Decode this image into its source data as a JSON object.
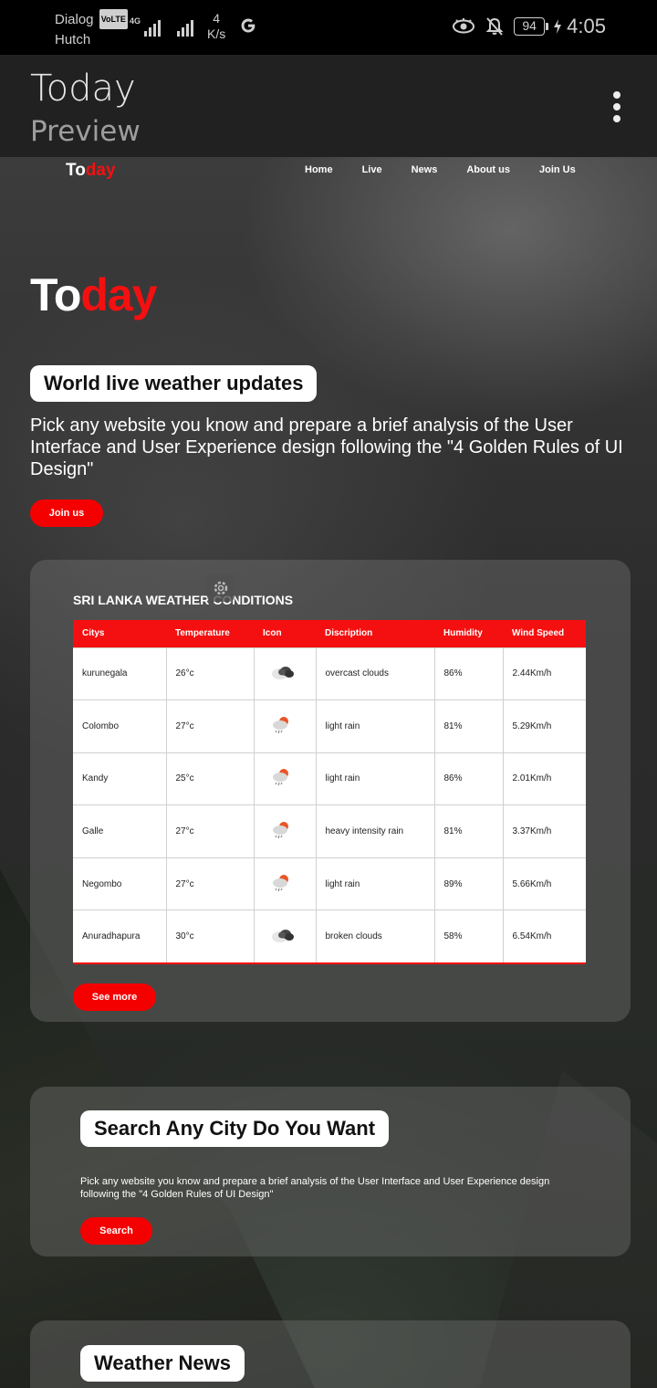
{
  "status_bar": {
    "carrier_1": "Dialog",
    "carrier_badge": "VoLTE",
    "carrier_2": "Hutch",
    "network": "4G",
    "speed_value": "4",
    "speed_unit": "K/s",
    "battery": "94",
    "time": "4:05"
  },
  "app_bar": {
    "title": "Today",
    "subtitle": "Preview"
  },
  "site": {
    "logo_a": "To",
    "logo_b": "day",
    "nav": [
      "Home",
      "Live",
      "News",
      "About us",
      "Join Us"
    ],
    "hero_logo_a": "To",
    "hero_logo_b": "day",
    "hero_title": "World live weather updates",
    "hero_text": "Pick any website you know and prepare a brief analysis of the User Interface and User Experience design following the \"4 Golden Rules of UI Design\"",
    "join_button": "Join us"
  },
  "weather": {
    "heading": "SRI LANKA WEATHER CONDITIONS",
    "columns": [
      "Citys",
      "Temperature",
      "Icon",
      "Discription",
      "Humidity",
      "Wind Speed"
    ],
    "rows": [
      {
        "city": "kurunegala",
        "temp": "26°c",
        "icon": "cloud-icon",
        "desc": "overcast clouds",
        "humidity": "86%",
        "wind": "2.44Km/h"
      },
      {
        "city": "Colombo",
        "temp": "27°c",
        "icon": "rain-icon",
        "desc": "light rain",
        "humidity": "81%",
        "wind": "5.29Km/h"
      },
      {
        "city": "Kandy",
        "temp": "25°c",
        "icon": "rain-icon",
        "desc": "light rain",
        "humidity": "86%",
        "wind": "2.01Km/h"
      },
      {
        "city": "Galle",
        "temp": "27°c",
        "icon": "rain-icon",
        "desc": "heavy intensity rain",
        "humidity": "81%",
        "wind": "3.37Km/h"
      },
      {
        "city": "Negombo",
        "temp": "27°c",
        "icon": "rain-icon",
        "desc": "light rain",
        "humidity": "89%",
        "wind": "5.66Km/h"
      },
      {
        "city": "Anuradhapura",
        "temp": "30°c",
        "icon": "cloud-icon",
        "desc": "broken clouds",
        "humidity": "58%",
        "wind": "6.54Km/h"
      }
    ],
    "see_more": "See more"
  },
  "search": {
    "title": "Search Any City Do You Want",
    "text": "Pick any website you know and prepare a brief analysis of the User Interface and User Experience design following the \"4 Golden Rules of UI Design\"",
    "button": "Search"
  },
  "news": {
    "title": "Weather News"
  },
  "colors": {
    "accent": "#f41010",
    "appbar": "#212121"
  }
}
